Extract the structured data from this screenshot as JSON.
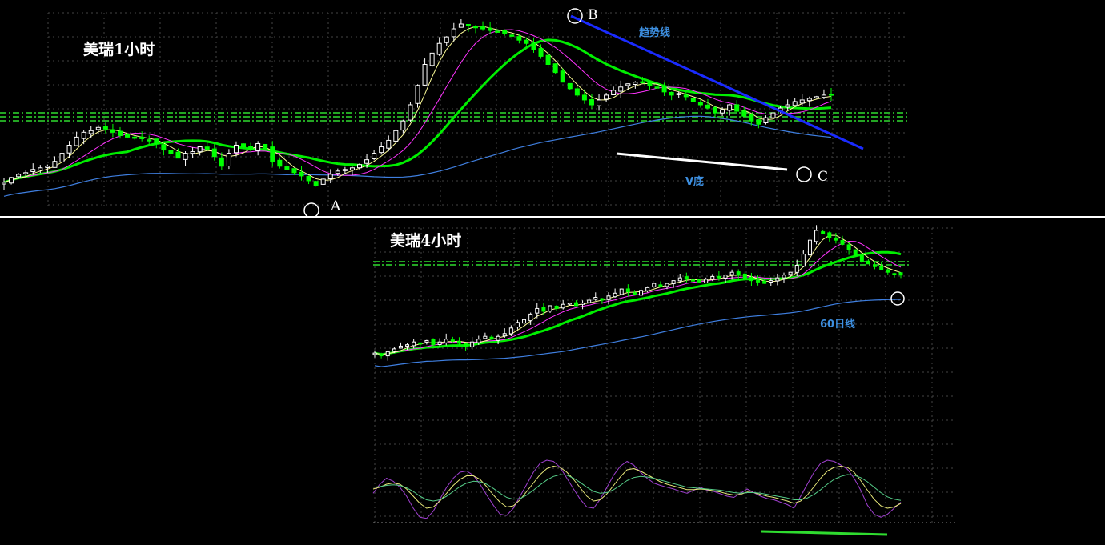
{
  "panels": {
    "top": {
      "title": "美瑞1小时",
      "annotations": {
        "trendline": "趋势线",
        "vbottom": "V底",
        "point_a": "A",
        "point_b": "B",
        "point_c": "C"
      }
    },
    "bottom": {
      "title": "美瑞4小时",
      "annotations": {
        "ma60": "60日线"
      }
    }
  },
  "colors": {
    "background": "#000000",
    "candle_up": "#ffffff",
    "candle_down": "#00ff00",
    "ma_fast": "#ffff99",
    "ma_mid": "#ff33ff",
    "ma_slow": "#00ee00",
    "ma60": "#3f7fe0",
    "trendline": "#1a2bff",
    "vbottom_line": "#ffffff",
    "grid": "#444444",
    "support": "#2fdc2f",
    "osc_a": "#a040d0",
    "osc_b": "#e8e87a",
    "osc_c": "#55cc88"
  },
  "chart_data": [
    {
      "name": "1-hour",
      "type": "candlestick",
      "indicators": [
        "MA-fast",
        "MA-mid",
        "MA-slow",
        "MA60",
        "trendline"
      ],
      "closes": [
        2,
        5,
        7,
        8,
        10,
        11,
        12,
        15,
        20,
        25,
        30,
        33,
        34,
        36,
        35,
        33,
        31,
        30,
        30,
        29,
        28,
        26,
        22,
        20,
        17,
        20,
        21,
        24,
        22,
        18,
        12,
        20,
        25,
        24,
        22,
        26,
        23,
        15,
        12,
        10,
        8,
        6,
        3,
        0,
        4,
        7,
        9,
        10,
        11,
        13,
        16,
        20,
        24,
        28,
        34,
        40,
        50,
        62,
        75,
        82,
        88,
        92,
        97,
        100,
        99,
        98,
        97,
        96,
        95,
        94,
        93,
        90,
        88,
        84,
        80,
        75,
        70,
        64,
        60,
        56,
        53,
        50,
        53,
        56,
        59,
        61,
        63,
        64,
        64,
        62,
        61,
        58,
        56,
        57,
        55,
        52,
        50,
        48,
        45,
        47,
        50,
        46,
        43,
        40,
        38,
        42,
        45,
        48,
        50,
        52,
        53,
        54,
        55,
        56,
        56
      ]
    },
    {
      "name": "4-hour",
      "type": "candlestick",
      "indicators": [
        "MA-fast",
        "MA-mid",
        "MA-slow",
        "MA60"
      ],
      "closes": [
        12,
        10,
        13,
        15,
        17,
        18,
        20,
        19,
        21,
        18,
        20,
        22,
        21,
        19,
        17,
        20,
        22,
        24,
        22,
        24,
        26,
        30,
        34,
        36,
        40,
        44,
        42,
        46,
        44,
        47,
        48,
        46,
        48,
        50,
        52,
        50,
        53,
        55,
        58,
        56,
        54,
        57,
        59,
        62,
        60,
        62,
        64,
        66,
        65,
        64,
        63,
        65,
        67,
        66,
        68,
        70,
        68,
        66,
        64,
        63,
        62,
        64,
        66,
        68,
        70,
        75,
        83,
        93,
        100,
        98,
        95,
        93,
        90,
        86,
        82,
        78,
        76,
        74,
        72,
        70,
        69,
        68
      ]
    },
    {
      "name": "oscillator",
      "type": "line",
      "series": [
        {
          "values": [
            45,
            60,
            70,
            65,
            55,
            40,
            20,
            5,
            3,
            15,
            35,
            55,
            70,
            80,
            82,
            75,
            60,
            42,
            25,
            10,
            8,
            20,
            40,
            60,
            80,
            95,
            100,
            98,
            88,
            70,
            52,
            35,
            22,
            20,
            35,
            55,
            75,
            90,
            98,
            92,
            80,
            70,
            62,
            58,
            55,
            52,
            48,
            45,
            50,
            55,
            50,
            48,
            44,
            40,
            38,
            45,
            52,
            46,
            40,
            36,
            34,
            30,
            26,
            20,
            40,
            60,
            80,
            95,
            100,
            98,
            92,
            85,
            70,
            50,
            25,
            10,
            5,
            10,
            20,
            30
          ]
        },
        {
          "values": [
            52,
            55,
            60,
            62,
            60,
            52,
            40,
            28,
            20,
            22,
            32,
            45,
            58,
            68,
            74,
            74,
            68,
            56,
            42,
            30,
            22,
            24,
            34,
            48,
            62,
            76,
            86,
            90,
            88,
            80,
            68,
            54,
            40,
            32,
            34,
            44,
            58,
            72,
            84,
            86,
            82,
            76,
            70,
            64,
            60,
            57,
            54,
            51,
            51,
            52,
            51,
            49,
            47,
            44,
            42,
            43,
            47,
            46,
            43,
            40,
            38,
            35,
            32,
            28,
            32,
            42,
            56,
            70,
            82,
            88,
            90,
            88,
            80,
            66,
            50,
            35,
            24,
            20,
            22,
            28
          ]
        },
        {
          "values": [
            55,
            56,
            58,
            59,
            58,
            54,
            48,
            40,
            34,
            32,
            34,
            40,
            48,
            56,
            62,
            65,
            64,
            60,
            53,
            45,
            38,
            35,
            36,
            42,
            50,
            59,
            67,
            73,
            76,
            75,
            70,
            63,
            55,
            48,
            45,
            46,
            51,
            58,
            66,
            71,
            73,
            72,
            70,
            67,
            64,
            61,
            58,
            55,
            54,
            53,
            52,
            51,
            50,
            48,
            46,
            45,
            46,
            46,
            45,
            43,
            41,
            39,
            37,
            34,
            34,
            37,
            43,
            51,
            60,
            68,
            73,
            76,
            75,
            71,
            64,
            55,
            46,
            39,
            35,
            33
          ]
        }
      ]
    }
  ]
}
